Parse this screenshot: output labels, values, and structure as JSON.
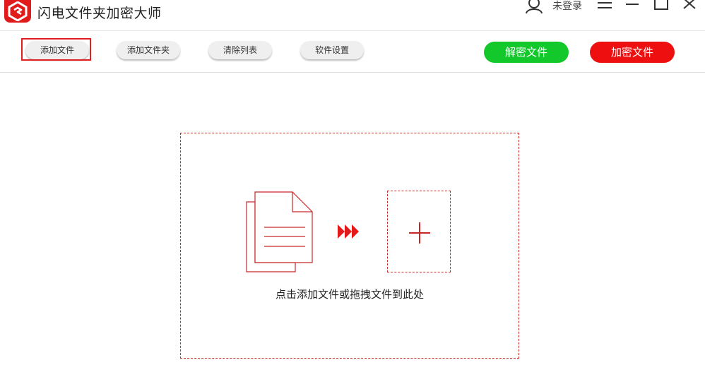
{
  "app": {
    "title": "闪电文件夹加密大师",
    "user_status": "未登录"
  },
  "toolbar": {
    "add_file": "添加文件",
    "add_folder": "添加文件夹",
    "clear_list": "清除列表",
    "settings": "软件设置",
    "decrypt": "解密文件",
    "encrypt": "加密文件"
  },
  "dropzone": {
    "hint": "点击添加文件或拖拽文件到此处"
  },
  "colors": {
    "brand_red": "#e11b1b",
    "decrypt_green": "#13c82b",
    "encrypt_red": "#ee1010"
  },
  "icons": [
    "app-logo-icon",
    "user-icon",
    "menu-icon",
    "minimize-icon",
    "maximize-icon",
    "close-icon",
    "document-icon",
    "arrows-icon",
    "plus-icon"
  ]
}
